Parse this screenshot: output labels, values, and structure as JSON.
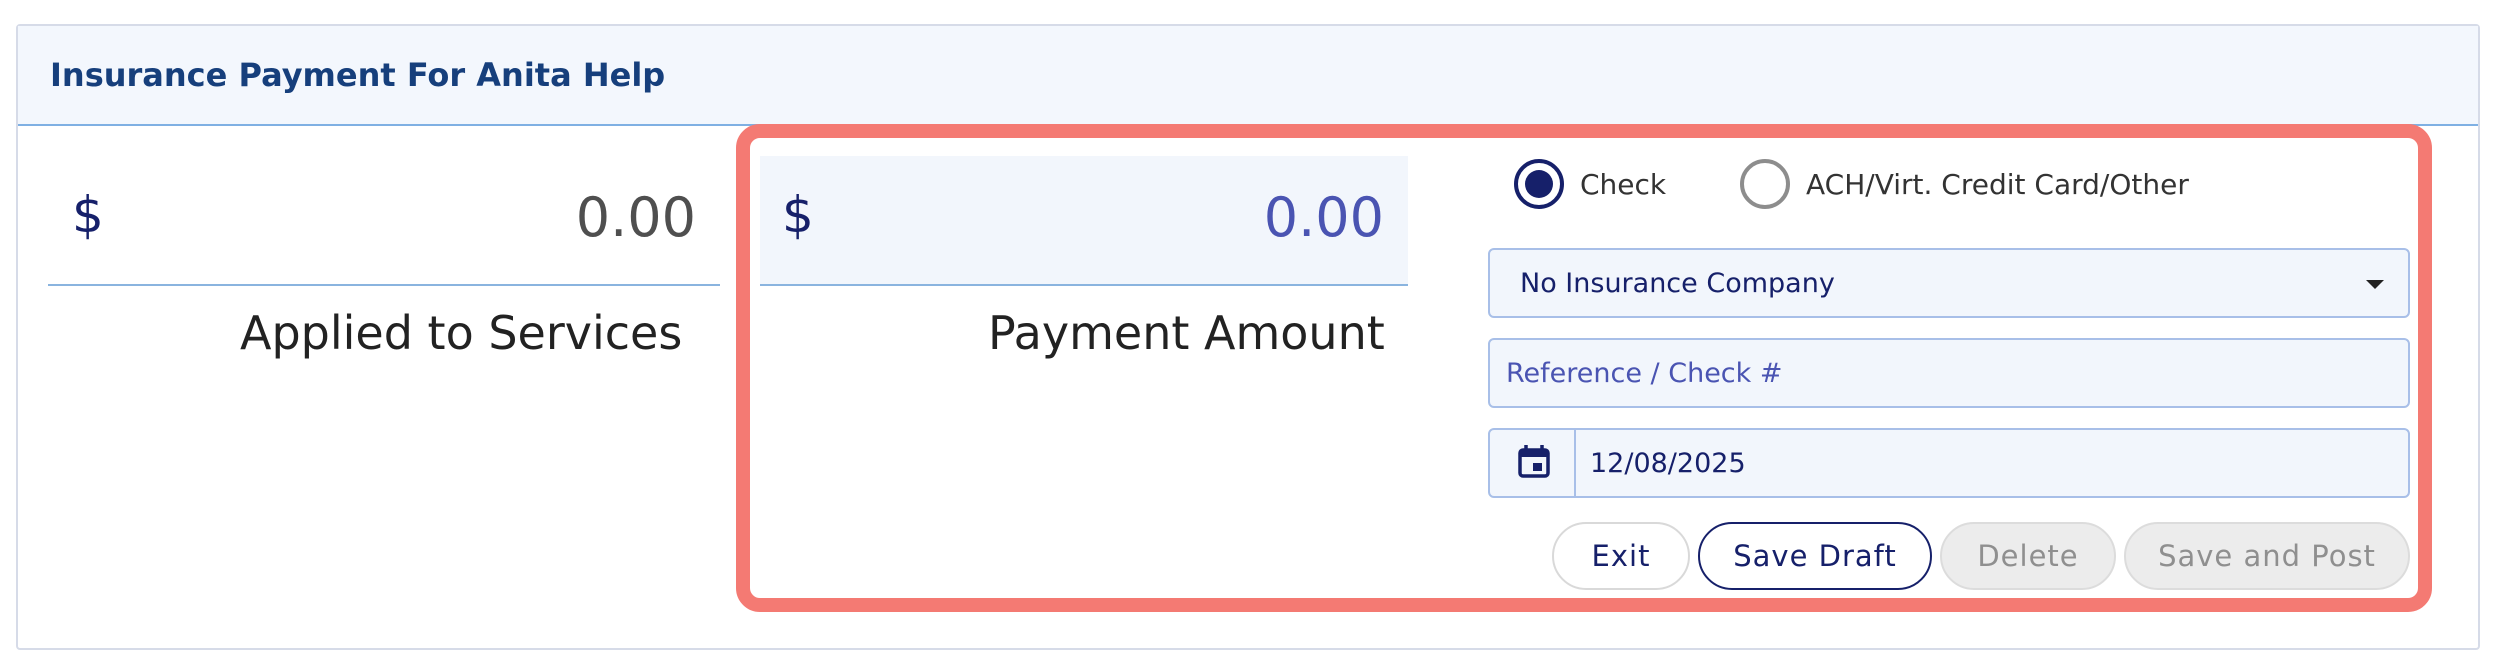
{
  "panel": {
    "title": "Insurance Payment For Anita Help"
  },
  "applied": {
    "currency": "$",
    "amount": "0.00",
    "caption": "Applied to Services"
  },
  "payment": {
    "currency": "$",
    "amount": "0.00",
    "caption": "Payment Amount"
  },
  "payment_method": {
    "options": [
      {
        "label": "Check",
        "selected": true
      },
      {
        "label": "ACH/Virt. Credit Card/Other",
        "selected": false
      }
    ]
  },
  "insurance_select": {
    "value": "No Insurance Company"
  },
  "reference": {
    "placeholder": "Reference / Check #",
    "value": ""
  },
  "date": {
    "value": "12/08/2025",
    "icon": "calendar-icon"
  },
  "buttons": {
    "exit": "Exit",
    "save_draft": "Save Draft",
    "delete": "Delete",
    "save_and_post": "Save and Post"
  },
  "colors": {
    "accent": "#16206a",
    "highlight": "#f47a73",
    "amount_active": "#4a54b2",
    "header_bg": "#f3f7fd"
  }
}
